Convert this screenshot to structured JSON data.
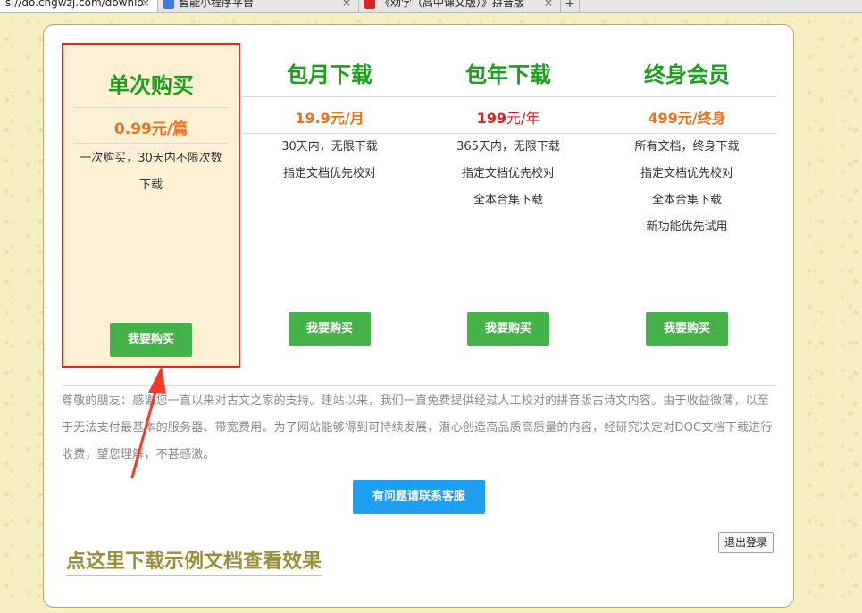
{
  "browser": {
    "tabs": [
      {
        "label": "s://do.cngwzj.com/downlo",
        "active": true
      },
      {
        "label": "智能小程序平台",
        "active": false
      },
      {
        "label": "《劝学（高中课文版）》拼音版",
        "active": false
      }
    ],
    "close_glyph": "×",
    "new_tab_glyph": "+"
  },
  "plans": [
    {
      "title": "单次购买",
      "price": "0.99元/篇",
      "price_color": "#e8711a",
      "features": [
        "一次购买，30天内不限次数下载"
      ],
      "button": "我要购买",
      "selected": true
    },
    {
      "title": "包月下载",
      "price": "19.9元/月",
      "price_color": "#e8711a",
      "features": [
        "30天内，无限下载",
        "指定文档优先校对"
      ],
      "button": "我要购买",
      "selected": false
    },
    {
      "title": "包年下载",
      "price_number": "199",
      "price_unit": "元/年",
      "price_color": "#d61f1f",
      "features": [
        "365天内，无限下载",
        "指定文档优先校对",
        "全本合集下载"
      ],
      "button": "我要购买",
      "selected": false
    },
    {
      "title": "终身会员",
      "price": "499元/终身",
      "price_color": "#e8711a",
      "features": [
        "所有文档，终身下载",
        "指定文档优先校对",
        "全本合集下载",
        "新功能优先试用"
      ],
      "button": "我要购买",
      "selected": false
    }
  ],
  "notice": "尊敬的朋友：感谢您一直以来对古文之家的支持。建站以来，我们一直免费提供经过人工校对的拼音版古诗文内容。由于收益微薄，以至于无法支付最基本的服务器、带宽费用。为了网站能够得到可持续发展，潜心创造高品质高质量的内容，经研究决定对DOC文档下载进行收费，望您理解，不甚感激。",
  "contact_button": "有问题请联系客服",
  "logout_button": "退出登录",
  "sample_link": "点这里下载示例文档查看效果",
  "colors": {
    "plan_title": "#1e9e1e",
    "buy_button": "#45b34a",
    "contact_button": "#1e9ff2",
    "selection_border": "#e4261f",
    "annotation_arrow": "#f03a2c"
  }
}
